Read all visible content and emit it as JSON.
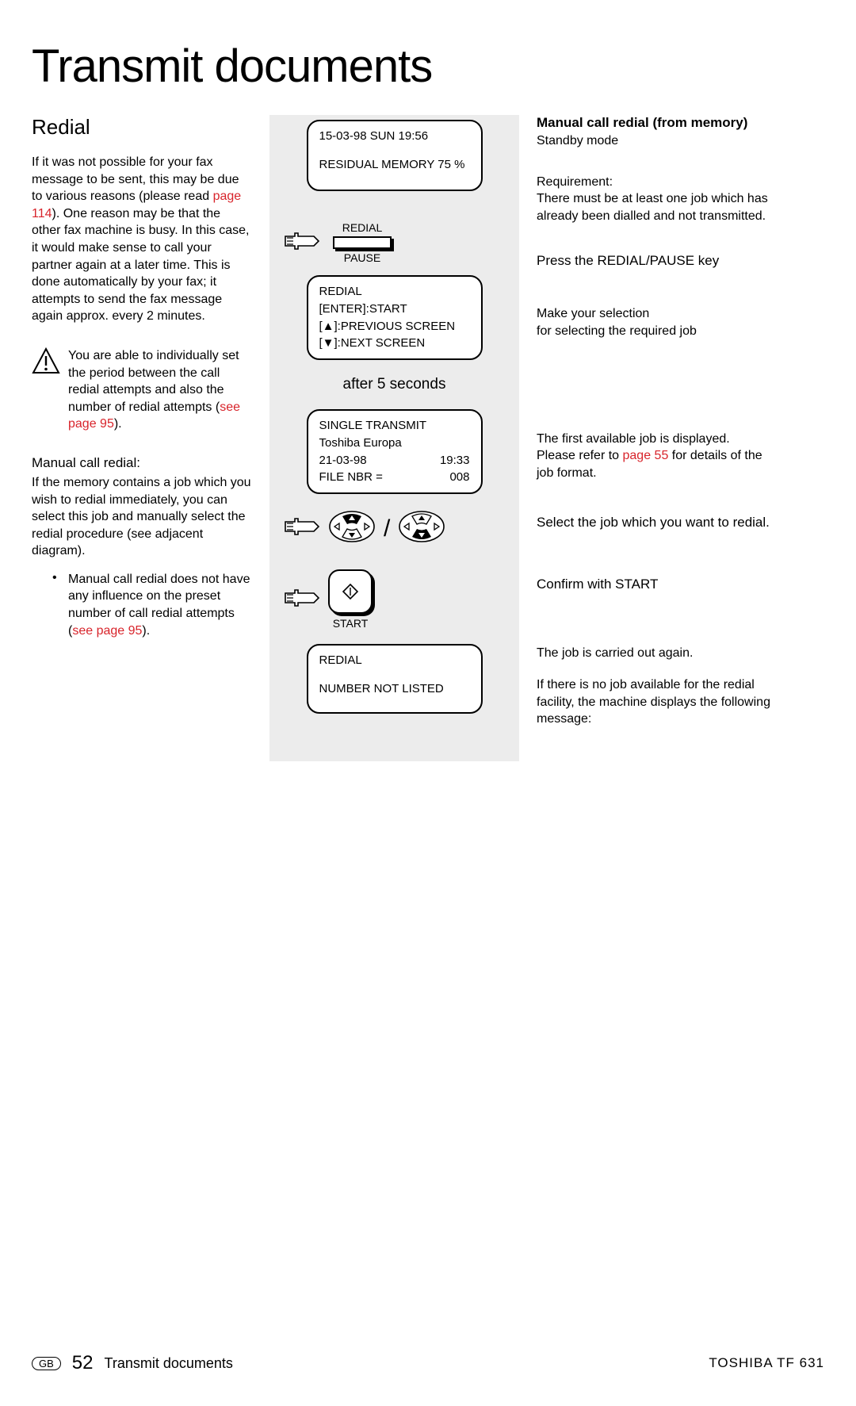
{
  "title": "Transmit documents",
  "left": {
    "h2": "Redial",
    "p1a": "If it was not possible for your fax message to be sent, this may be due to various reasons (please read ",
    "p1_link": "page 114",
    "p1b": "). One reason may be that the other fax machine is busy. In this case, it would make sense to call your partner again at a later time. This is done automatically by your fax; it attempts to send the fax message again approx. every 2 minutes.",
    "warn_a": "You are able to individually set the period between the call redial attempts and also the number of redial attempts (",
    "warn_link": "see page 95",
    "warn_b": ").",
    "sub": "Manual call redial:",
    "p2": "If the memory contains a job which you wish to redial immediately, you can select this job and manually select the redial procedure (see adjacent diagram).",
    "bullet_a": "Manual call redial does not have any influence on the preset number of call redial attempts (",
    "bullet_link": "see page 95",
    "bullet_b": ")."
  },
  "mid": {
    "lcd1_l1": "15-03-98   SUN    19:56",
    "lcd1_l2": "RESIDUAL MEMORY 75 %",
    "redial_label": "REDIAL",
    "pause_label": "PAUSE",
    "lcd2_l1": "REDIAL",
    "lcd2_l2": "[ENTER]:START",
    "lcd2_l3": "[▲]:PREVIOUS SCREEN",
    "lcd2_l4": "[▼]:NEXT SCREEN",
    "after": "after 5 seconds",
    "lcd3_l1": "SINGLE TRANSMIT",
    "lcd3_l2": "Toshiba Europa",
    "lcd3_l3a": "21-03-98",
    "lcd3_l3b": "19:33",
    "lcd3_l4a": "FILE NBR =",
    "lcd3_l4b": "008",
    "start_label": "START",
    "lcd4_l1": "REDIAL",
    "lcd4_l2": "NUMBER NOT LISTED"
  },
  "right": {
    "h": "Manual call redial (from memory)",
    "standby": "Standby mode",
    "req_label": "Requirement:",
    "req_text": "There must be at least one job which has already been dialled and not transmitted.",
    "step1": "Press the REDIAL/PAUSE key",
    "sel1": "Make your selection",
    "sel2": "for selecting the required job",
    "job1": "The first available job is displayed.",
    "job2a": "Please refer to ",
    "job2_link": "page 55",
    "job2b": " for details of the job format.",
    "step2": "Select the job which you want to redial.",
    "step3": "Confirm with START",
    "carry": "The job is carried out again.",
    "nojob": "If there is no job available for the redial facility, the machine displays the following message:"
  },
  "footer": {
    "gb": "GB",
    "page": "52",
    "chapter": "Transmit documents",
    "brand": "TOSHIBA    TF 631"
  }
}
